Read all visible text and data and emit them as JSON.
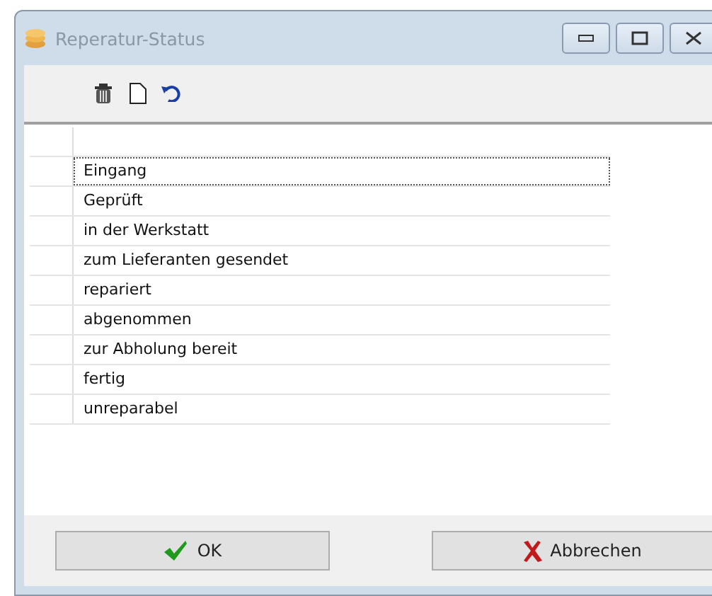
{
  "window": {
    "title": "Reperatur-Status"
  },
  "rows": [
    {
      "label": "Eingang",
      "selected": true
    },
    {
      "label": "Geprüft",
      "selected": false
    },
    {
      "label": "in der Werkstatt",
      "selected": false
    },
    {
      "label": "zum Lieferanten gesendet",
      "selected": false
    },
    {
      "label": "repariert",
      "selected": false
    },
    {
      "label": "abgenommen",
      "selected": false
    },
    {
      "label": "zur Abholung bereit",
      "selected": false
    },
    {
      "label": "fertig",
      "selected": false
    },
    {
      "label": "unreparabel",
      "selected": false
    }
  ],
  "buttons": [
    {
      "label": "OK",
      "kind": "ok"
    },
    {
      "label": "Abbrechen",
      "kind": "cancel"
    }
  ]
}
